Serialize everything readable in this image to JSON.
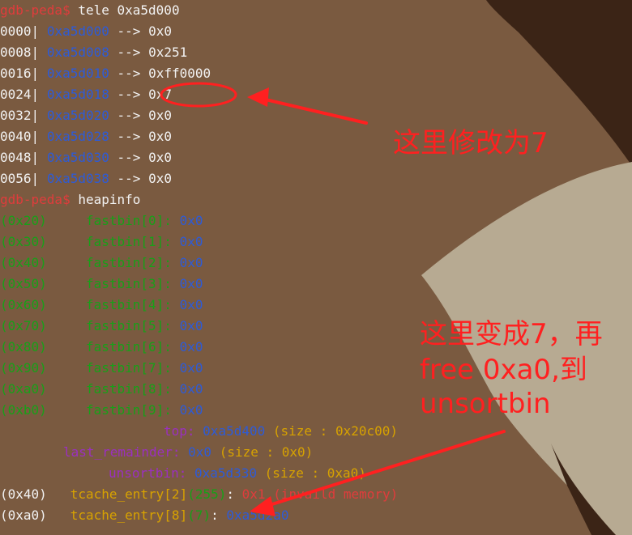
{
  "lines": [
    {
      "prompt": "gdb-peda$",
      "cmd": "tele 0xa5d000"
    },
    {
      "off": "0000|",
      "addr": "0xa5d000",
      "arrow": "-->",
      "val": "0x0"
    },
    {
      "off": "0008|",
      "addr": "0xa5d008",
      "arrow": "-->",
      "val": "0x251"
    },
    {
      "off": "0016|",
      "addr": "0xa5d010",
      "arrow": "-->",
      "val": "0xff0000"
    },
    {
      "off": "0024|",
      "addr": "0xa5d018",
      "arrow": "-->",
      "val": "0x7"
    },
    {
      "off": "0032|",
      "addr": "0xa5d020",
      "arrow": "-->",
      "val": "0x0"
    },
    {
      "off": "0040|",
      "addr": "0xa5d028",
      "arrow": "-->",
      "val": "0x0"
    },
    {
      "off": "0048|",
      "addr": "0xa5d030",
      "arrow": "-->",
      "val": "0x0"
    },
    {
      "off": "0056|",
      "addr": "0xa5d038",
      "arrow": "-->",
      "val": "0x0"
    },
    {
      "prompt": "gdb-peda$",
      "cmd": "heapinfo"
    },
    {
      "size": "(0x20)",
      "bin": "fastbin[0]:",
      "val": "0x0"
    },
    {
      "size": "(0x30)",
      "bin": "fastbin[1]:",
      "val": "0x0"
    },
    {
      "size": "(0x40)",
      "bin": "fastbin[2]:",
      "val": "0x0"
    },
    {
      "size": "(0x50)",
      "bin": "fastbin[3]:",
      "val": "0x0"
    },
    {
      "size": "(0x60)",
      "bin": "fastbin[4]:",
      "val": "0x0"
    },
    {
      "size": "(0x70)",
      "bin": "fastbin[5]:",
      "val": "0x0"
    },
    {
      "size": "(0x80)",
      "bin": "fastbin[6]:",
      "val": "0x0"
    },
    {
      "size": "(0x90)",
      "bin": "fastbin[7]:",
      "val": "0x0"
    },
    {
      "size": "(0xa0)",
      "bin": "fastbin[8]:",
      "val": "0x0"
    },
    {
      "size": "(0xb0)",
      "bin": "fastbin[9]:",
      "val": "0x0"
    },
    {
      "label": "top:",
      "val": "0xa5d400",
      "extra": "(size : 0x20c00)"
    },
    {
      "label": "last_remainder:",
      "val": "0x0",
      "extra": "(size : 0x0)"
    },
    {
      "label": "unsortbin:",
      "val": "0xa5d330",
      "extra": "(size : 0xa0)"
    },
    {
      "size": "(0x40)",
      "entry": "tcache_entry[2]",
      "count": "(255)",
      "colon": ":",
      "val": "0x1 (invaild memory)"
    },
    {
      "size": "(0xa0)",
      "entry": "tcache_entry[8]",
      "count": "(7)",
      "colon": ":",
      "val": "0xa5d2a0"
    }
  ],
  "annotations": {
    "note1": "这里修改为7",
    "note2_line1": "这里变成7，再",
    "note2_line2": "free 0xa0,到",
    "note2_line3": "unsortbin"
  },
  "colors": {
    "background": "#7a5a40",
    "prompt": "#e03c3c",
    "text": "#f3f3f3",
    "address": "#2d5bd8",
    "fastbin": "#18a018",
    "size_info": "#d7a200",
    "last_remainder": "#9b2fc0",
    "annotation": "#ff2020"
  }
}
